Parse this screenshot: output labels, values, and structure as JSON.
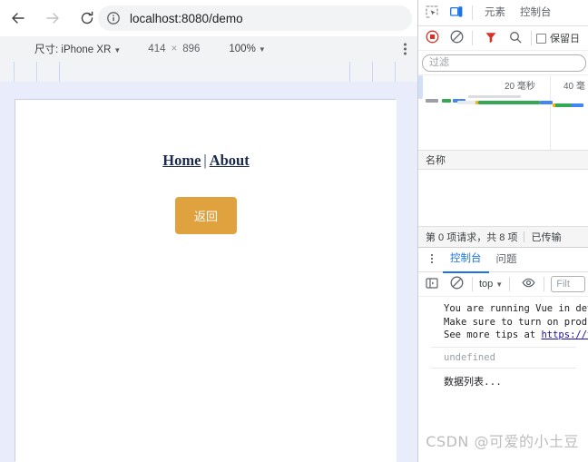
{
  "browser": {
    "back_icon": "arrow-left-icon",
    "forward_icon": "arrow-right-icon",
    "reload_icon": "reload-icon",
    "site_info_icon": "info-circle-icon",
    "url": "localhost:8080/demo"
  },
  "device_toolbar": {
    "size_label": "尺寸: iPhone XR",
    "width": "414",
    "times": "×",
    "height": "896",
    "zoom": "100%",
    "more_icon": "kebab-menu-icon"
  },
  "page": {
    "nav": {
      "home": "Home",
      "separator": "|",
      "about": "About"
    },
    "back_button": "返回",
    "button_color": "#e0a13f"
  },
  "devtools": {
    "inspect_icon": "inspect-element-icon",
    "device_toggle_icon": "device-toolbar-icon",
    "tabs": [
      {
        "label": "元素",
        "active": false
      },
      {
        "label": "控制台",
        "active": false
      }
    ],
    "network": {
      "record_icon": "record-stop-icon",
      "clear_icon": "clear-icon",
      "filter_icon": "filter-funnel-icon",
      "search_icon": "search-icon",
      "preserve_log_label": "保留日",
      "filter_placeholder": "过滤",
      "timeline": {
        "tick_1": "20 毫秒",
        "tick_2": "40 毫"
      },
      "column_name": "名称",
      "status_requests": "第 0 项请求，共 8 项",
      "status_transferred": "已传输 "
    },
    "drawer": {
      "more_icon": "kebab-menu-icon",
      "tabs": [
        {
          "label": "控制台",
          "active": true
        },
        {
          "label": "问题",
          "active": false
        }
      ],
      "sidebar_icon": "sidebar-toggle-icon",
      "clear_icon": "clear-icon",
      "context": "top",
      "eye_icon": "eye-icon",
      "filter_placeholder": "Filt",
      "messages": {
        "vue_line_1": "You are running Vue in dev",
        "vue_line_2": "Make sure to turn on produ",
        "vue_line_3_prefix": "See more tips at ",
        "vue_link": "https://v",
        "undefined": "undefined",
        "data_list": "数据列表..."
      }
    }
  },
  "watermark": "CSDN @可爱的小土豆"
}
